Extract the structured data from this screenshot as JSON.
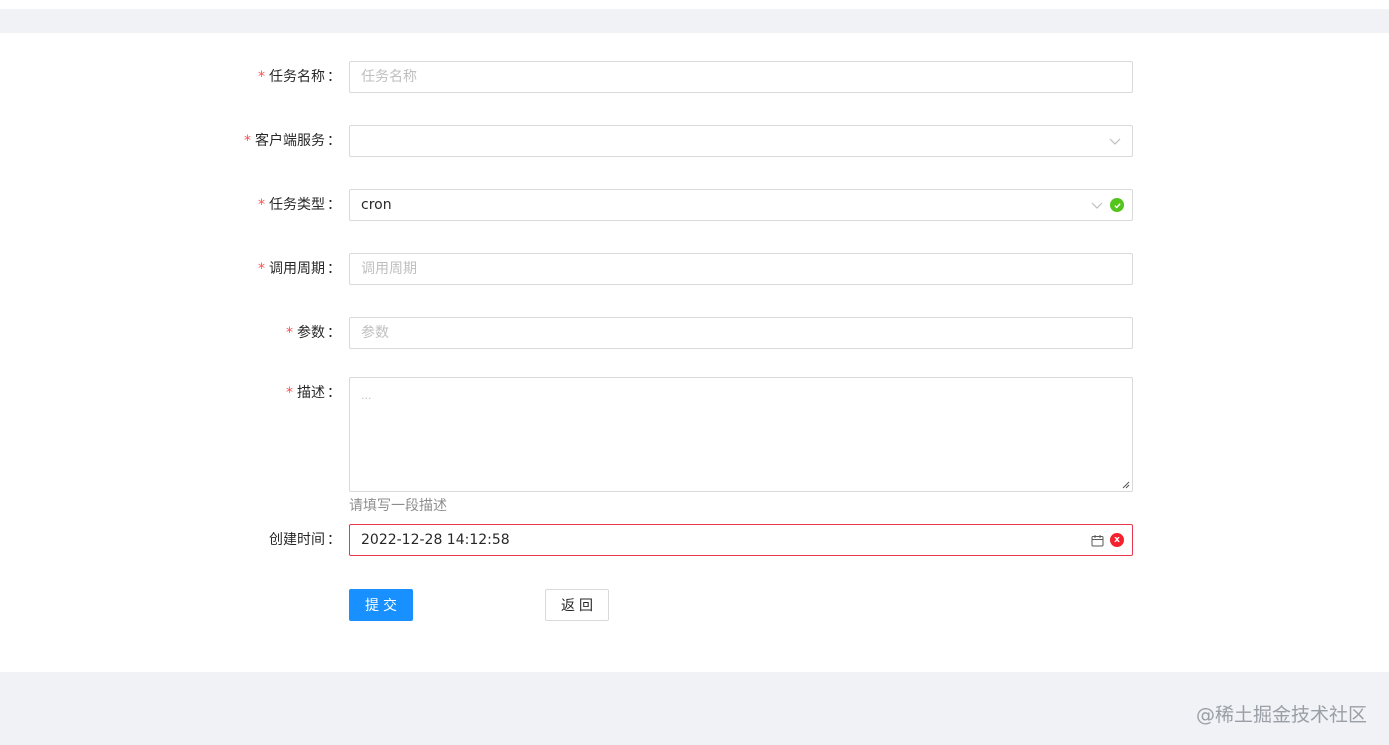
{
  "form": {
    "task_name": {
      "label": "任务名称",
      "placeholder": "任务名称",
      "required": true
    },
    "client_service": {
      "label": "客户端服务",
      "value": "",
      "required": true
    },
    "task_type": {
      "label": "任务类型",
      "value": "cron",
      "required": true,
      "status": "success"
    },
    "schedule": {
      "label": "调用周期",
      "placeholder": "调用周期",
      "required": true
    },
    "params": {
      "label": "参数",
      "placeholder": "参数",
      "required": true
    },
    "description": {
      "label": "描述",
      "placeholder": "...",
      "help": "请填写一段描述",
      "required": true
    },
    "created_time": {
      "label": "创建时间",
      "value": "2022-12-28 14:12:58",
      "required": false,
      "status": "error"
    },
    "colon": "："
  },
  "buttons": {
    "submit": "提交",
    "back": "返回"
  },
  "watermark": "@稀土掘金技术社区",
  "colors": {
    "primary": "#1890ff",
    "required": "#ff4d4f",
    "success": "#52c41a",
    "error": "#f5222d"
  },
  "icons": [
    "chevron-down-icon",
    "check-circle-icon",
    "calendar-icon",
    "close-circle-icon"
  ]
}
